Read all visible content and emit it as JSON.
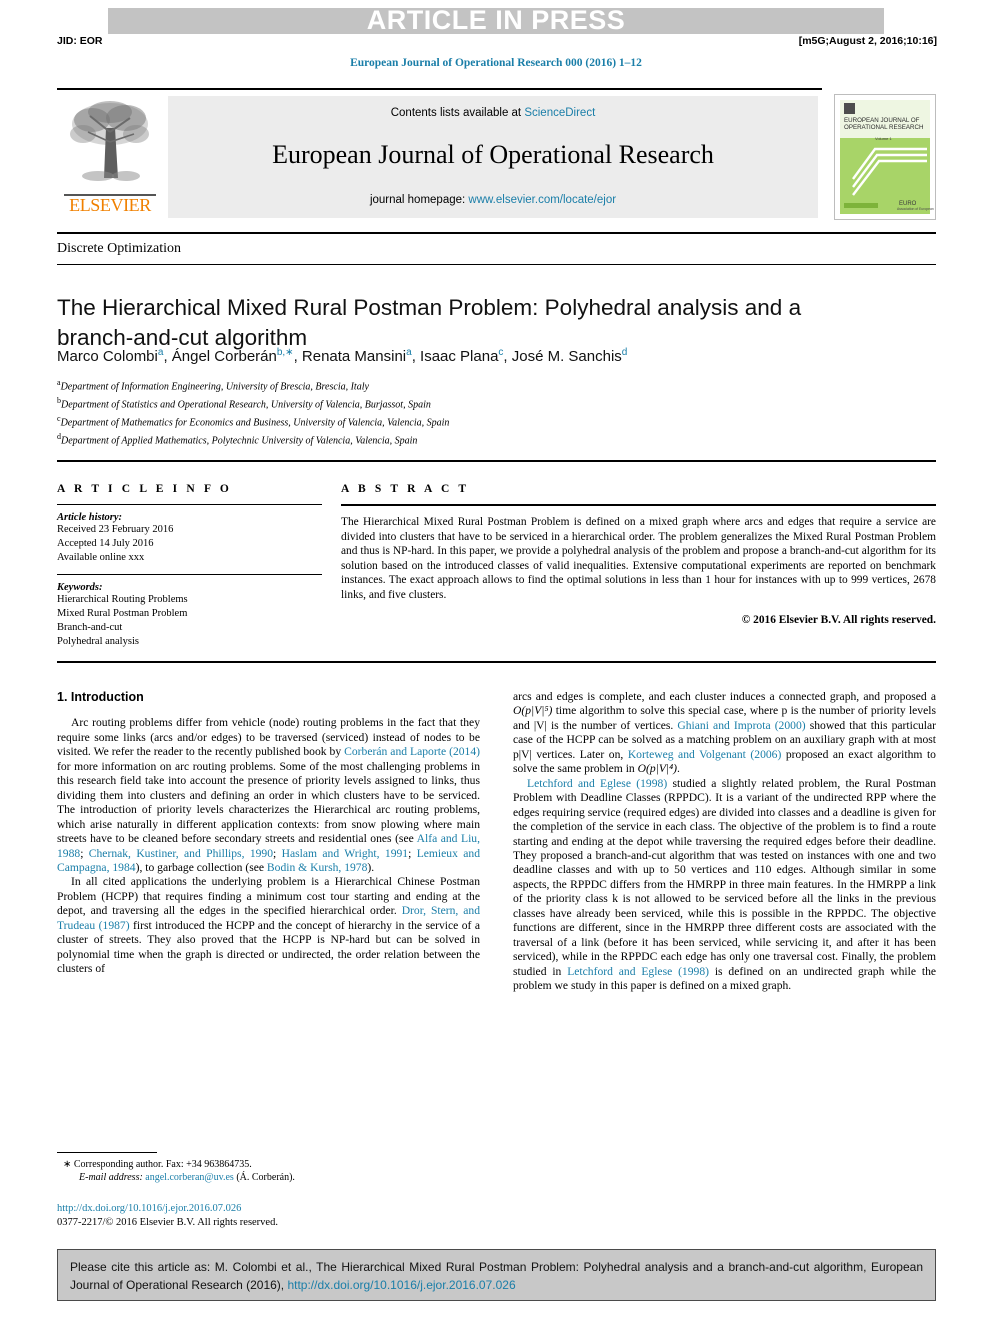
{
  "header": {
    "banner": "ARTICLE IN PRESS",
    "jid": "JID: EOR",
    "stamp": "[m5G;August 2, 2016;10:16]",
    "running_head": "European Journal of Operational Research 000 (2016) 1–12"
  },
  "masthead": {
    "contents_prefix": "Contents lists available at ",
    "sciencedirect": "ScienceDirect",
    "journal_title": "European Journal of Operational Research",
    "homepage_prefix": "journal homepage: ",
    "homepage_url": "www.elsevier.com/locate/ejor",
    "publisher": "ELSEVIER",
    "cover_title": "EUROPEAN JOURNAL OF OPERATIONAL RESEARCH",
    "cover_subtitle": "Volume 1",
    "cover_footer": "EURO"
  },
  "article": {
    "category": "Discrete Optimization",
    "title": "The Hierarchical Mixed Rural Postman Problem: Polyhedral analysis and a branch-and-cut algorithm",
    "authors_html": "Marco Colombi<sup>a</sup>, Ángel Corberán<sup>b,∗</sup>, Renata Mansini<sup>a</sup>, Isaac Plana<sup>c</sup>, José M. Sanchis<sup>d</sup>",
    "affiliations": [
      {
        "mark": "a",
        "text": "Department of Information Engineering, University of Brescia, Brescia, Italy"
      },
      {
        "mark": "b",
        "text": "Department of Statistics and Operational Research, University of Valencia, Burjassot, Spain"
      },
      {
        "mark": "c",
        "text": "Department of Mathematics for Economics and Business, University of Valencia, Valencia, Spain"
      },
      {
        "mark": "d",
        "text": "Department of Applied Mathematics, Polytechnic University of Valencia, Valencia, Spain"
      }
    ]
  },
  "article_info": {
    "heading": "A R T I C L E    I N F O",
    "history_label": "Article history:",
    "history": [
      "Received 23 February 2016",
      "Accepted 14 July 2016",
      "Available online xxx"
    ],
    "keywords_label": "Keywords:",
    "keywords": [
      "Hierarchical Routing Problems",
      "Mixed Rural Postman Problem",
      "Branch-and-cut",
      "Polyhedral analysis"
    ]
  },
  "abstract": {
    "heading": "A B S T R A C T",
    "text": "The Hierarchical Mixed Rural Postman Problem is defined on a mixed graph where arcs and edges that require a service are divided into clusters that have to be serviced in a hierarchical order. The problem generalizes the Mixed Rural Postman Problem and thus is NP-hard. In this paper, we provide a polyhedral analysis of the problem and propose a branch-and-cut algorithm for its solution based on the introduced classes of valid inequalities. Extensive computational experiments are reported on benchmark instances. The exact approach allows to find the optimal solutions in less than 1 hour for instances with up to 999 vertices, 2678 links, and five clusters.",
    "copyright": "© 2016 Elsevier B.V. All rights reserved."
  },
  "body": {
    "section_title": "1. Introduction",
    "left_p1_a": "Arc routing problems differ from vehicle (node) routing problems in the fact that they require some links (arcs and/or edges) to be traversed (serviced) instead of nodes to be visited. We refer the reader to the recently published book by ",
    "left_p1_ref1": "Corberán and Laporte (2014)",
    "left_p1_b": " for more information on arc routing problems. Some of the most challenging problems in this research field take into account the presence of priority levels assigned to links, thus dividing them into clusters and defining an order in which clusters have to be serviced. The introduction of priority levels characterizes the Hierarchical arc routing problems, which arise naturally in different application contexts: from snow plowing where main streets have to be cleaned before secondary streets and residential ones (see ",
    "left_p1_ref2": "Alfa and Liu, 1988",
    "left_p1_c": "; ",
    "left_p1_ref3": "Chernak, Kustiner, and Phillips, 1990",
    "left_p1_d": "; ",
    "left_p1_ref4": "Haslam and Wright, 1991",
    "left_p1_e": "; ",
    "left_p1_ref5": "Lemieux and Campagna, 1984",
    "left_p1_f": "), to garbage collection (see ",
    "left_p1_ref6": "Bodin & Kursh, 1978",
    "left_p1_g": ").",
    "left_p2_a": "In all cited applications the underlying problem is a Hierarchical Chinese Postman Problem (HCPP) that requires finding a minimum cost tour starting and ending at the depot, and traversing all the edges in the specified hierarchical order. ",
    "left_p2_ref1": "Dror, Stern, and Trudeau (1987)",
    "left_p2_b": " first introduced the HCPP and the concept of hierarchy in the service of a cluster of streets. They also proved that the HCPP is NP-hard but can be solved in polynomial time when the graph is directed or undirected, the order relation between the clusters of",
    "right_p1_a": "arcs and edges is complete, and each cluster induces a connected graph, and proposed a ",
    "right_p1_math1": "O(p|V|⁵)",
    "right_p1_b": " time algorithm to solve this special case, where p is the number of priority levels and |V| is the number of vertices. ",
    "right_p1_ref1": "Ghiani and Improta (2000)",
    "right_p1_c": " showed that this particular case of the HCPP can be solved as a matching problem on an auxiliary graph with at most p|V| vertices. Later on, ",
    "right_p1_ref2": "Korteweg and Volgenant (2006)",
    "right_p1_d": " proposed an exact algorithm to solve the same problem in ",
    "right_p1_math2": "O(p|V|⁴)",
    "right_p1_e": ".",
    "right_p2_ref1": "Letchford and Eglese (1998)",
    "right_p2_a": " studied a slightly related problem, the Rural Postman Problem with Deadline Classes (RPPDC). It is a variant of the undirected RPP where the edges requiring service (required edges) are divided into classes and a deadline is given for the completion of the service in each class. The objective of the problem is to find a route starting and ending at the depot while traversing the required edges before their deadline. They proposed a branch-and-cut algorithm that was tested on instances with one and two deadline classes and with up to 50 vertices and 110 edges. Although similar in some aspects, the RPPDC differs from the HMRPP in three main features. In the HMRPP a link of the priority class k is not allowed to be serviced before all the links in the previous classes have already been serviced, while this is possible in the RPPDC. The objective functions are different, since in the HMRPP three different costs are associated with the traversal of a link (before it has been serviced, while servicing it, and after it has been serviced), while in the RPPDC each edge has only one traversal cost. Finally, the problem studied in ",
    "right_p2_ref2": "Letchford and Eglese (1998)",
    "right_p2_b": " is defined on an undirected graph while the problem we study in this paper is defined on a mixed graph."
  },
  "footnote": {
    "corresponding": "∗ Corresponding author. Fax: +34 963864735.",
    "email_label": "E-mail address:",
    "email": "angel.corberan@uv.es",
    "email_suffix": " (Á. Corberán).",
    "doi": "http://dx.doi.org/10.1016/j.ejor.2016.07.026",
    "issn_line": "0377-2217/© 2016 Elsevier B.V. All rights reserved."
  },
  "cite_box": {
    "text_a": "Please cite this article as: M. Colombi et al., The Hierarchical Mixed Rural Postman Problem: Polyhedral analysis and a branch-and-cut algorithm, European Journal of Operational Research (2016), ",
    "doi": "http://dx.doi.org/10.1016/j.ejor.2016.07.026"
  },
  "colors": {
    "link": "#1a7ea8",
    "banner_bg": "#c3c3c3",
    "masthead_bg": "#ececec",
    "elsevier_orange": "#f08000",
    "cite_bg": "#c8c8c8",
    "cover_green": "#8dc63f"
  }
}
